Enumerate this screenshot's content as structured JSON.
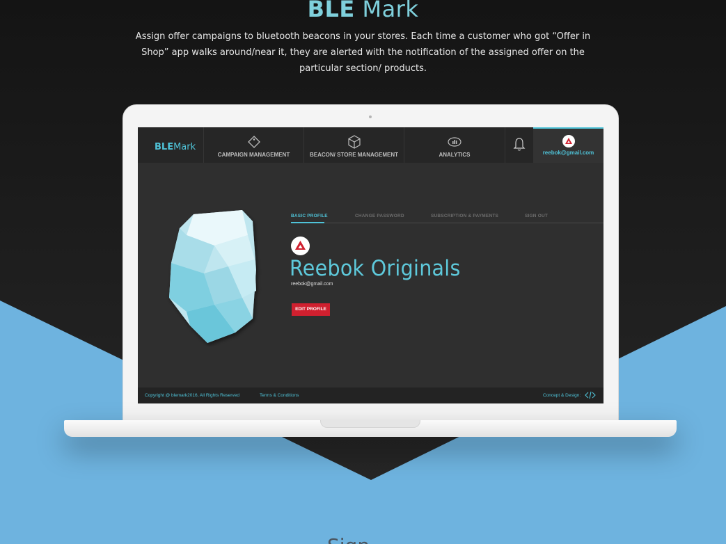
{
  "hero": {
    "brand_ble": "BLE",
    "brand_mark": "Mark",
    "description": "Assign offer campaigns to bluetooth beacons in your stores. Each time a customer who got “Offer in Shop” app walks around/near it, they are alerted with the notification of the assigned offer on the particular section/ products."
  },
  "app": {
    "logo": "BLE",
    "logo_suffix": "Mark",
    "nav": [
      {
        "label": "CAMPAIGN MANAGEMENT",
        "icon": "tag-icon"
      },
      {
        "label": "BEACON/ STORE MANAGEMENT",
        "icon": "cube-icon"
      },
      {
        "label": "ANALYTICS",
        "icon": "chart-eye-icon"
      }
    ],
    "account_email": "reebok@gmail.com",
    "tabs": [
      "BASIC PROFILE",
      "CHANGE PASSWORD",
      "SUBSCRIPTION & PAYMENTS",
      "SIGN OUT"
    ],
    "profile": {
      "name": "Reebok Originals",
      "email": "reebok@gmail.com",
      "edit_label": "EDIT PROFILE"
    },
    "footer": {
      "copyright": "Copyright @ blemark2016, All Rights Reserved",
      "terms": "Terms & Conditions",
      "concept": "Concept & Design:"
    }
  },
  "next_section_peek": "Sign ",
  "colors": {
    "accent": "#4fc3d8",
    "danger": "#d0202f",
    "page_bg": "#6eb3df"
  }
}
